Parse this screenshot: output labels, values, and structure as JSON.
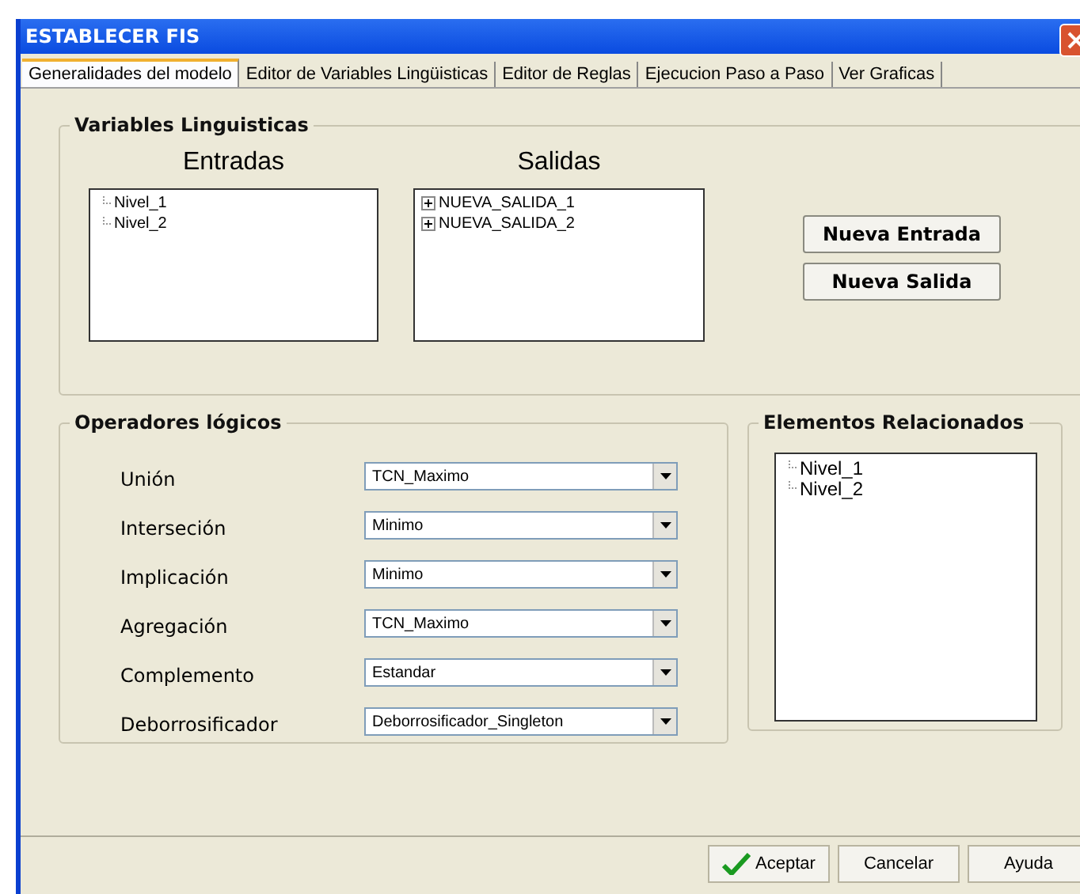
{
  "window": {
    "title": "ESTABLECER FIS"
  },
  "tabs": [
    {
      "label": "Generalidades del modelo",
      "selected": true
    },
    {
      "label": "Editor de Variables Lingüisticas",
      "selected": false
    },
    {
      "label": "Editor de Reglas",
      "selected": false
    },
    {
      "label": "Ejecucion Paso a Paso",
      "selected": false
    },
    {
      "label": "Ver Graficas",
      "selected": false
    }
  ],
  "variables": {
    "title": "Variables Linguisticas",
    "inputs": {
      "heading": "Entradas",
      "items": [
        {
          "label": "Nivel_1",
          "expandable": false
        },
        {
          "label": "Nivel_2",
          "expandable": false
        }
      ]
    },
    "outputs": {
      "heading": "Salidas",
      "items": [
        {
          "label": "NUEVA_SALIDA_1",
          "expandable": true
        },
        {
          "label": "NUEVA_SALIDA_2",
          "expandable": true
        }
      ]
    },
    "buttons": [
      "Nueva Entrada",
      "Nueva Salida"
    ]
  },
  "operators": {
    "title": "Operadores lógicos",
    "rows": [
      {
        "label": "Unión",
        "value": "TCN_Maximo"
      },
      {
        "label": "Interseción",
        "value": "Minimo"
      },
      {
        "label": "Implicación",
        "value": "Minimo"
      },
      {
        "label": "Agregación",
        "value": "TCN_Maximo"
      },
      {
        "label": "Complemento",
        "value": "Estandar"
      },
      {
        "label": "Deborrosificador",
        "value": "Deborrosificador_Singleton"
      }
    ]
  },
  "related": {
    "title": "Elementos Relacionados",
    "items": [
      {
        "label": "Nivel_1",
        "expandable": false
      },
      {
        "label": "Nivel_2",
        "expandable": false
      }
    ]
  },
  "footer_buttons": [
    {
      "label": "Aceptar",
      "kind": "ok"
    },
    {
      "label": "Cancelar",
      "kind": "plain"
    },
    {
      "label": "Ayuda",
      "kind": "plain"
    }
  ]
}
